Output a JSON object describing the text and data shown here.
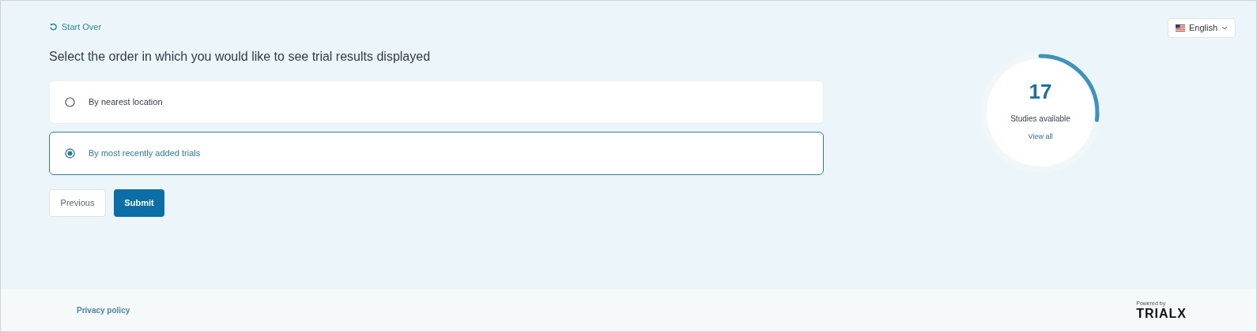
{
  "start_over": "Start Over",
  "language": {
    "label": "English"
  },
  "question": "Select the order in which you would like to see trial results displayed",
  "options": [
    {
      "label": "By nearest location",
      "selected": false
    },
    {
      "label": "By most recently added trials",
      "selected": true
    }
  ],
  "buttons": {
    "previous": "Previous",
    "submit": "Submit"
  },
  "studies": {
    "count": "17",
    "label": "Studies available",
    "link": "View all",
    "level": 0.27
  },
  "footer": {
    "privacy": "Privacy policy",
    "powered_by": "Powered by",
    "brand": "TRIALX"
  }
}
